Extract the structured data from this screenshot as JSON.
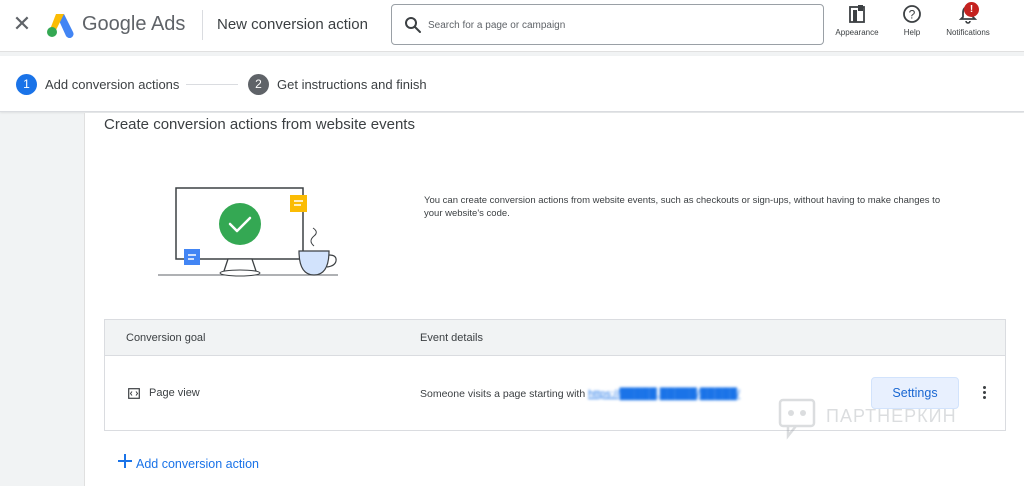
{
  "header": {
    "brand": "Google Ads",
    "page_title": "New conversion action",
    "search_placeholder": "Search for a page or campaign",
    "tools": [
      {
        "label": "Appearance",
        "icon": "appearance-icon"
      },
      {
        "label": "Help",
        "icon": "help-icon"
      },
      {
        "label": "Notifications",
        "icon": "bell-icon",
        "badge": "!"
      }
    ]
  },
  "stepper": {
    "steps": [
      {
        "number": "1",
        "label": "Add conversion actions",
        "active": true
      },
      {
        "number": "2",
        "label": "Get instructions and finish",
        "active": false
      }
    ]
  },
  "main": {
    "section_title": "Create conversion actions from website events",
    "intro_text": "You can create conversion actions from website events, such as checkouts or sign-ups, without having to make changes to your website's code.",
    "table": {
      "headers": [
        "Conversion goal",
        "Event details"
      ],
      "rows": [
        {
          "goal": "Page view",
          "event_prefix": "Someone visits a page starting with ",
          "event_link": "https://█████.█████/█████/",
          "settings_label": "Settings"
        }
      ]
    },
    "add_action_label": "Add conversion action"
  },
  "watermark": "ПАРТНЕРКИН",
  "colors": {
    "accent": "#1a73e8",
    "step_active": "#1a73e8",
    "step_inactive": "#5f6368",
    "check_green": "#34a853",
    "note_yellow": "#fbbc04",
    "badge_red": "#c5221f"
  }
}
